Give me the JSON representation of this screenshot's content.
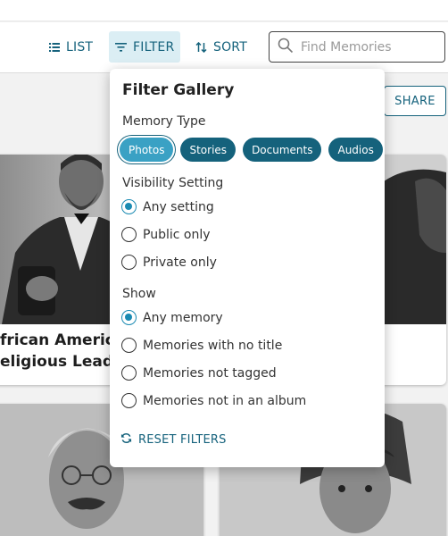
{
  "toolbar": {
    "list_label": "LIST",
    "filter_label": "FILTER",
    "sort_label": "SORT",
    "search_placeholder": "Find Memories"
  },
  "share_label": "SHARE",
  "cards": [
    {
      "title_line1": "frican America",
      "title_line2": "eligious Leade"
    }
  ],
  "filter_panel": {
    "title": "Filter Gallery",
    "memory_type_label": "Memory Type",
    "memory_types": [
      {
        "label": "Photos",
        "selected": true
      },
      {
        "label": "Stories",
        "selected": false
      },
      {
        "label": "Documents",
        "selected": false
      },
      {
        "label": "Audios",
        "selected": false
      }
    ],
    "visibility_label": "Visibility Setting",
    "visibility_options": [
      {
        "label": "Any setting",
        "selected": true
      },
      {
        "label": "Public only",
        "selected": false
      },
      {
        "label": "Private only",
        "selected": false
      }
    ],
    "show_label": "Show",
    "show_options": [
      {
        "label": "Any memory",
        "selected": true
      },
      {
        "label": "Memories with no title",
        "selected": false
      },
      {
        "label": "Memories not tagged",
        "selected": false
      },
      {
        "label": "Memories not in an album",
        "selected": false
      }
    ],
    "reset_label": "RESET FILTERS"
  },
  "colors": {
    "accent": "#15627c",
    "chip_active": "#3aa1c4",
    "radio_on": "#1a8ab2",
    "filter_active_bg": "#dbeef4"
  }
}
